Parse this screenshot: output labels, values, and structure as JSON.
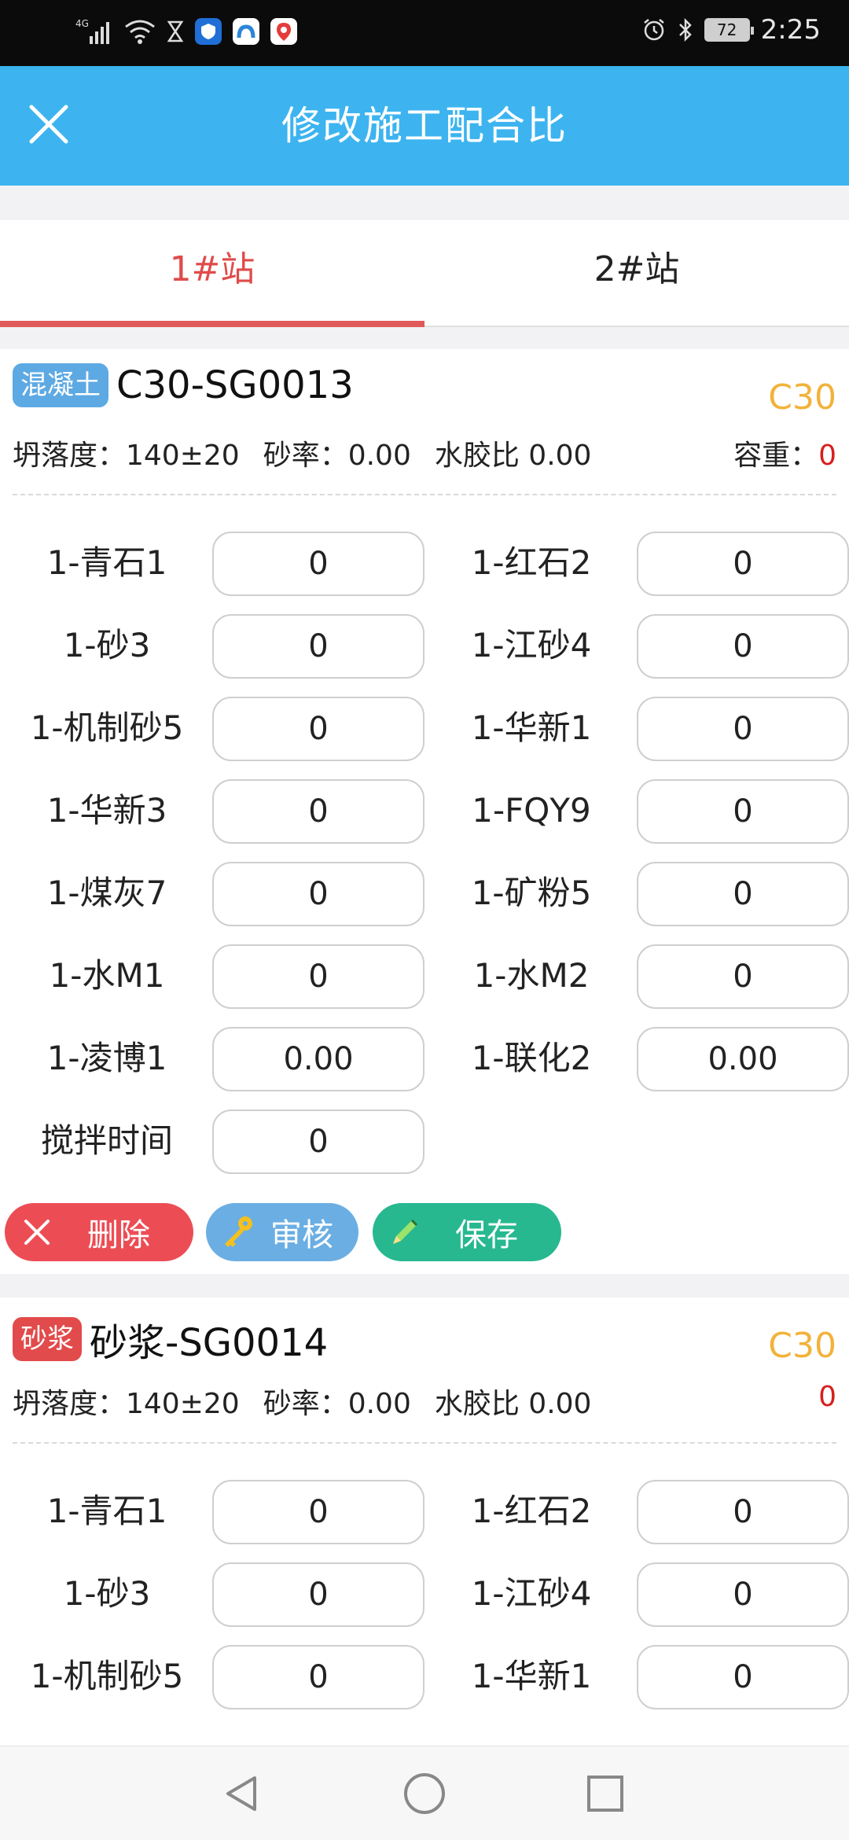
{
  "statusbar": {
    "network": "4G",
    "battery": "72",
    "time": "2:25"
  },
  "header": {
    "title": "修改施工配合比"
  },
  "tabs": [
    {
      "label": "1#站"
    },
    {
      "label": "2#站"
    }
  ],
  "cards": [
    {
      "tag": "混凝土",
      "title": "C30-SG0013",
      "grade": "C30",
      "slump": "坍落度：140±20",
      "sand_ratio": "砂率：0.00",
      "wb_ratio": "水胶比 0.00",
      "density_label": "容重：",
      "density_value": "0",
      "fields": [
        {
          "label": "1-青石1",
          "value": "0"
        },
        {
          "label": "1-红石2",
          "value": "0"
        },
        {
          "label": "1-砂3",
          "value": "0"
        },
        {
          "label": "1-江砂4",
          "value": "0"
        },
        {
          "label": "1-机制砂5",
          "value": "0"
        },
        {
          "label": "1-华新1",
          "value": "0"
        },
        {
          "label": "1-华新3",
          "value": "0"
        },
        {
          "label": "1-FQY9",
          "value": "0"
        },
        {
          "label": "1-煤灰7",
          "value": "0"
        },
        {
          "label": "1-矿粉5",
          "value": "0"
        },
        {
          "label": "1-水M1",
          "value": "0"
        },
        {
          "label": "1-水M2",
          "value": "0"
        },
        {
          "label": "1-凌博1",
          "value": "0.00"
        },
        {
          "label": "1-联化2",
          "value": "0.00"
        },
        {
          "label": "搅拌时间",
          "value": "0"
        }
      ],
      "buttons": {
        "delete": "删除",
        "review": "审核",
        "save": "保存"
      }
    },
    {
      "tag": "砂浆",
      "title": "砂浆-SG0014",
      "grade": "C30",
      "slump": "坍落度：140±20",
      "sand_ratio": "砂率：0.00",
      "wb_ratio": "水胶比 0.00",
      "density_value": "0",
      "fields": [
        {
          "label": "1-青石1",
          "value": "0"
        },
        {
          "label": "1-红石2",
          "value": "0"
        },
        {
          "label": "1-砂3",
          "value": "0"
        },
        {
          "label": "1-江砂4",
          "value": "0"
        },
        {
          "label": "1-机制砂5",
          "value": "0"
        },
        {
          "label": "1-华新1",
          "value": "0"
        }
      ]
    }
  ],
  "colors": {
    "header": "#3db4ef",
    "tab_active": "#e04b4b",
    "grade": "#f2b23a",
    "delete": "#ec4d55",
    "review": "#6aaee3",
    "save": "#27b890"
  }
}
